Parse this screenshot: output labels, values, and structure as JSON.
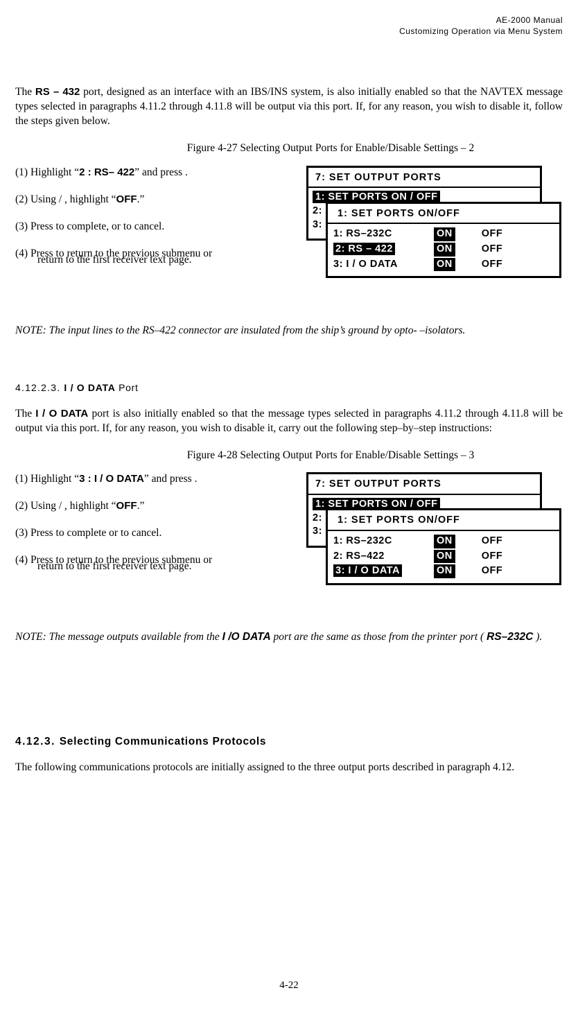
{
  "header": {
    "line1": "AE-2000 Manual",
    "line2": "Customizing Operation via Menu System"
  },
  "intro1_a": "The ",
  "intro1_rs": "RS – 432",
  "intro1_b": " port, designed as an interface with an IBS/INS system, is also initially enabled so that the NAVTEX message types selected in paragraphs 4.11.2 through 4.11.8 will be output via this port. If, for any reason, you wish to disable it, follow the steps given below.",
  "fig27": "Figure 4-27  Selecting Output Ports for Enable/Disable Settings – 2",
  "steps_a": {
    "s1a": "(1)  Highlight “",
    "s1b": "2 : RS– 422",
    "s1c": "” and press       .",
    "s2a": "(2)  Using     /    , highlight “",
    "s2b": "OFF",
    "s2c": ".”",
    "s3": "(3)  Press       to complete, or       to  cancel.",
    "s4": "(4) Press       to return to the previous submenu or",
    "s4b": "return to the first receiver text page."
  },
  "menu1": {
    "back_title": "7: SET OUTPUT PORTS",
    "back_hi": "1: SET PORTS ON / OFF",
    "back_r2": "2:",
    "back_r3": "3:",
    "front_title": "1: SET PORTS ON/OFF",
    "r1": "1: RS–232C",
    "r2": "2: RS – 422",
    "r3": "3: I / O DATA",
    "on": "ON",
    "off": "OFF"
  },
  "note1_a": "NOTE: The input lines to the RS–422 connector are insulated from the ship’s ground by opto- –isolators.",
  "subsec": {
    "num": "4.12.2.3.  ",
    "title_bold": "I / O DATA",
    "title_rest": " Port"
  },
  "intro2_a": "The ",
  "intro2_io": "I / O DATA",
  "intro2_b": " port is also initially enabled so that the message types selected in paragraphs 4.11.2 through 4.11.8 will be output via this port. If, for any reason, you wish to disable it, carry out the following step–by–step instructions:",
  "fig28": "Figure 4-28  Selecting Output Ports for Enable/Disable Settings – 3",
  "steps_b": {
    "s1a": "(1)  Highlight “",
    "s1b": "3 : I / O DATA",
    "s1c": "” and press       .",
    "s2a": "(2)  Using     /    , highlight “",
    "s2b": "OFF",
    "s2c": ".”",
    "s3": "(3)  Press       to complete or       to  cancel.",
    "s4": "(4) Press       to return to the previous submenu or",
    "s4b": "return to the first receiver text page."
  },
  "menu2": {
    "r1": "1: RS–232C",
    "r2": "2: RS–422",
    "r3": "3: I / O DATA"
  },
  "note2_a": "NOTE: The message outputs available from the ",
  "note2_io": "I /O DATA",
  "note2_b": " port are the same as those from the printer port ( ",
  "note2_rs": "RS–232C",
  "note2_c": " ).",
  "bighd": {
    "num": "4.12.3.  ",
    "title": "Selecting Communications Protocols"
  },
  "closing": "The following communications protocols are initially assigned to the three output ports described in paragraph 4.12.",
  "footer": "4-22"
}
